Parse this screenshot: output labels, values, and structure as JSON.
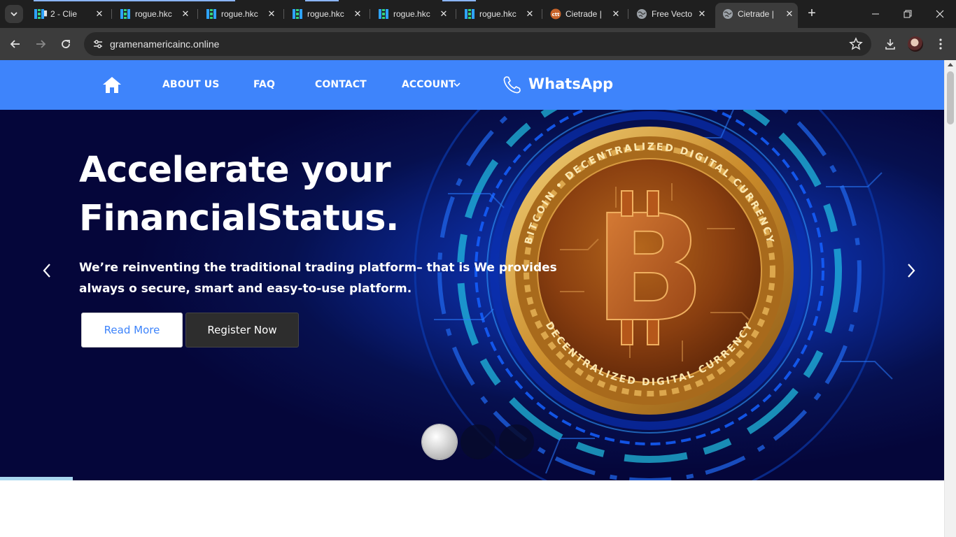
{
  "browser": {
    "tabs": [
      {
        "title": "2 - Clie",
        "icon": "chat-favicon-icon",
        "active": false
      },
      {
        "title": "rogue.hkc",
        "icon": "grid-favicon-icon",
        "active": false
      },
      {
        "title": "rogue.hkc",
        "icon": "grid-favicon-icon",
        "active": false
      },
      {
        "title": "rogue.hkc",
        "icon": "grid-favicon-icon",
        "active": false
      },
      {
        "title": "rogue.hkc",
        "icon": "grid-favicon-icon",
        "active": false
      },
      {
        "title": "rogue.hkc",
        "icon": "grid-favicon-icon",
        "active": false
      },
      {
        "title": "Cietrade |",
        "icon": "cietrade-favicon-icon",
        "active": false
      },
      {
        "title": "Free Vecto",
        "icon": "globe-favicon-icon",
        "active": false
      },
      {
        "title": "Cietrade |",
        "icon": "globe-favicon-icon",
        "active": true
      }
    ],
    "url": "gramenamericainc.online"
  },
  "site": {
    "nav": {
      "home_icon": "home-icon",
      "items": [
        "ABOUT US",
        "FAQ",
        "CONTACT",
        "ACCOUNT"
      ],
      "whatsapp_label": "WhatsApp"
    },
    "hero": {
      "title_line1": "Accelerate your",
      "title_line2": "FinancialStatus.",
      "subtitle": "We’re reinventing the traditional trading platform– that is We provides always o secure, smart and easy-to-use platform.",
      "read_more": "Read More",
      "register_now": "Register Now",
      "coin_text_top": "BITCOIN • DECENTRALIZED DIGITAL CURRENCY",
      "coin_text_bottom": "DECENTRALIZED DIGITAL CURRENCY",
      "slides": 3,
      "active_slide": 1
    }
  },
  "colors": {
    "nav_blue": "#3e84fb",
    "hero_dark": "#05063a",
    "coin_gold": "#c98a2a",
    "ring_cyan": "#22c3e6"
  }
}
